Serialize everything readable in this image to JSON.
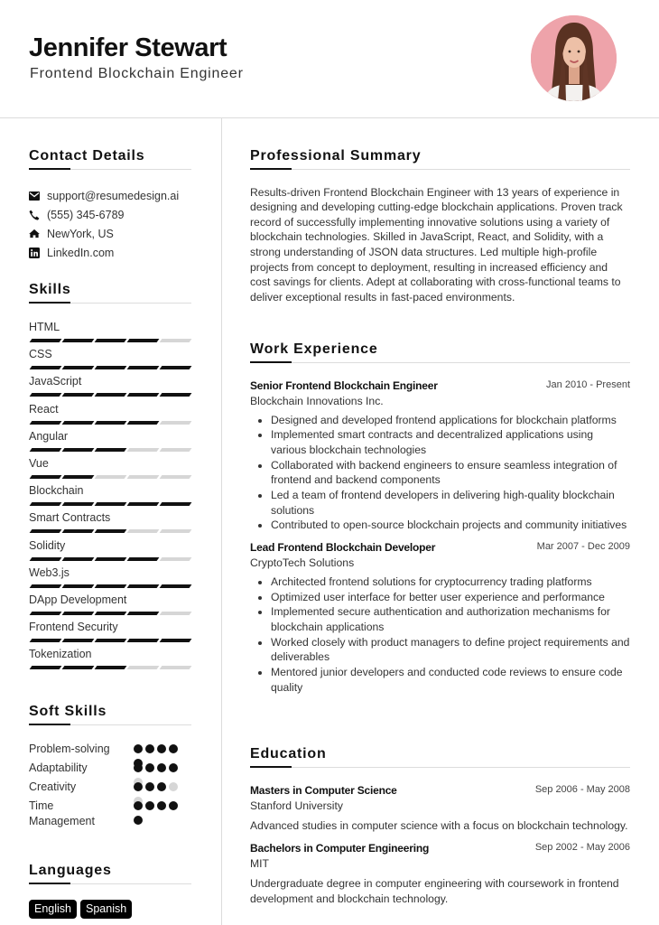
{
  "header": {
    "name": "Jennifer Stewart",
    "title": "Frontend Blockchain Engineer"
  },
  "contact": {
    "heading": "Contact Details",
    "items": [
      {
        "icon": "envelope-icon",
        "text": "support@resumedesign.ai"
      },
      {
        "icon": "phone-icon",
        "text": "(555) 345-6789"
      },
      {
        "icon": "home-icon",
        "text": "NewYork, US"
      },
      {
        "icon": "linkedin-icon",
        "text": "LinkedIn.com"
      }
    ]
  },
  "skills": {
    "heading": "Skills",
    "max_level": 5,
    "items": [
      {
        "name": "HTML",
        "level": 4
      },
      {
        "name": "CSS",
        "level": 5
      },
      {
        "name": "JavaScript",
        "level": 5
      },
      {
        "name": "React",
        "level": 4
      },
      {
        "name": "Angular",
        "level": 3
      },
      {
        "name": "Vue",
        "level": 2
      },
      {
        "name": "Blockchain",
        "level": 5
      },
      {
        "name": "Smart Contracts",
        "level": 3
      },
      {
        "name": "Solidity",
        "level": 4
      },
      {
        "name": "Web3.js",
        "level": 5
      },
      {
        "name": "DApp Development",
        "level": 4
      },
      {
        "name": "Frontend Security",
        "level": 5
      },
      {
        "name": "Tokenization",
        "level": 3
      }
    ]
  },
  "soft_skills": {
    "heading": "Soft Skills",
    "max_level": 5,
    "items": [
      {
        "name": "Problem-solving",
        "level": 5
      },
      {
        "name": "Adaptability",
        "level": 4
      },
      {
        "name": "Creativity",
        "level": 3
      },
      {
        "name": "Time Management",
        "level": 5
      }
    ]
  },
  "languages": {
    "heading": "Languages",
    "items": [
      "English",
      "Spanish"
    ]
  },
  "summary": {
    "heading": "Professional Summary",
    "text": "Results-driven Frontend Blockchain Engineer with 13 years of experience in designing and developing cutting-edge blockchain applications. Proven track record of successfully implementing innovative solutions using a variety of blockchain technologies. Skilled in JavaScript, React, and Solidity, with a strong understanding of JSON data structures. Led multiple high-profile projects from concept to deployment, resulting in increased efficiency and cost savings for clients. Adept at collaborating with cross-functional teams to deliver exceptional results in fast-paced environments."
  },
  "experience": {
    "heading": "Work Experience",
    "jobs": [
      {
        "title": "Senior Frontend Blockchain Engineer",
        "company": "Blockchain Innovations Inc.",
        "dates": "Jan 2010 - Present",
        "bullets": [
          "Designed and developed frontend applications for blockchain platforms",
          "Implemented smart contracts and decentralized applications using various blockchain technologies",
          "Collaborated with backend engineers to ensure seamless integration of frontend and backend components",
          "Led a team of frontend developers in delivering high-quality blockchain solutions",
          "Contributed to open-source blockchain projects and community initiatives"
        ]
      },
      {
        "title": "Lead Frontend Blockchain Developer",
        "company": "CryptoTech Solutions",
        "dates": "Mar 2007 - Dec 2009",
        "bullets": [
          "Architected frontend solutions for cryptocurrency trading platforms",
          "Optimized user interface for better user experience and performance",
          "Implemented secure authentication and authorization mechanisms for blockchain applications",
          "Worked closely with product managers to define project requirements and deliverables",
          "Mentored junior developers and conducted code reviews to ensure code quality"
        ]
      }
    ]
  },
  "education": {
    "heading": "Education",
    "entries": [
      {
        "degree": "Masters in Computer Science",
        "school": "Stanford University",
        "dates": "Sep 2006 - May 2008",
        "description": "Advanced studies in computer science with a focus on blockchain technology."
      },
      {
        "degree": "Bachelors in Computer Engineering",
        "school": "MIT",
        "dates": "Sep 2002 - May 2006",
        "description": "Undergraduate degree in computer engineering with coursework in frontend development and blockchain technology."
      }
    ]
  },
  "colors": {
    "ink": "#111111",
    "text": "#333333",
    "divider": "#dcdcdc",
    "empty_level": "#d6d6d6",
    "photo_background": "#eea3aa",
    "badge_background": "#000000"
  }
}
